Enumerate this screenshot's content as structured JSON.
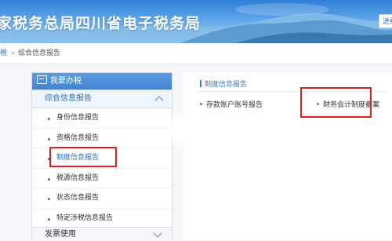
{
  "header": {
    "title": "家税务总局四川省电子税务局",
    "button_label": "进给",
    "colors": {
      "sky_top": "#2f7fd6",
      "sky_bottom": "#9fd0f6"
    }
  },
  "breadcrumb": {
    "home": "税",
    "separator": ">",
    "current": "综合信息报告"
  },
  "sidebar": {
    "header": "我要办税",
    "group": "综合信息报告",
    "items": [
      {
        "label": "身份信息报告"
      },
      {
        "label": "资格信息报告"
      },
      {
        "label": "制度信息报告"
      },
      {
        "label": "税源信息报告"
      },
      {
        "label": "状态信息报告"
      },
      {
        "label": "特定涉税信息报告"
      }
    ],
    "footer": "发票使用"
  },
  "main": {
    "section_title": "制度信息报告",
    "links": [
      {
        "label": "存款账户账号报告"
      },
      {
        "label": "财务会计制度备案"
      }
    ]
  },
  "colors": {
    "accent": "#2a6cc4",
    "highlight": "#e01f1f"
  }
}
